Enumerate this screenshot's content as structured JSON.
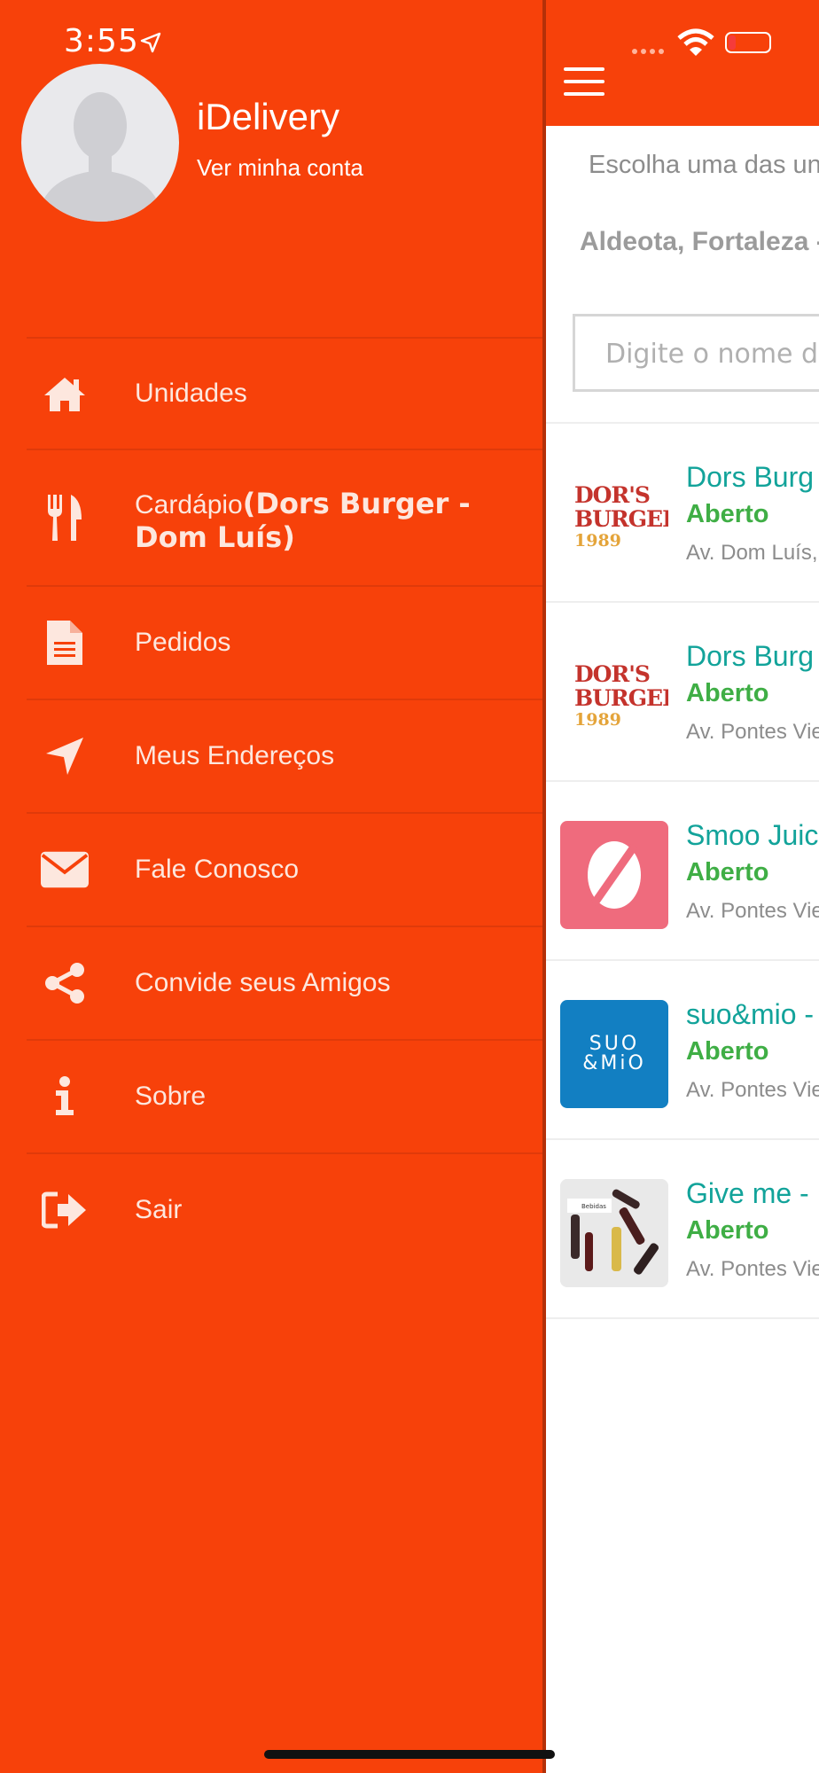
{
  "status_bar": {
    "time": "3:55"
  },
  "drawer": {
    "profile": {
      "name": "iDelivery",
      "link": "Ver minha conta"
    },
    "menu": [
      {
        "label": "Unidades",
        "icon": "home-icon"
      },
      {
        "label": "Cardápio",
        "label_bold": "(Dors Burger - Dom Luís)",
        "icon": "utensils-icon"
      },
      {
        "label": "Pedidos",
        "icon": "document-icon"
      },
      {
        "label": "Meus Endereços",
        "icon": "location-arrow-icon"
      },
      {
        "label": "Fale Conosco",
        "icon": "envelope-icon"
      },
      {
        "label": "Convide seus Amigos",
        "icon": "share-icon"
      },
      {
        "label": "Sobre",
        "icon": "info-icon"
      },
      {
        "label": "Sair",
        "icon": "sign-out-icon"
      }
    ]
  },
  "main": {
    "choose_text": "Escolha uma das unida",
    "location": "Aldeota, Fortaleza -",
    "search": {
      "placeholder": "Digite o nome do"
    },
    "units": [
      {
        "name": "Dors Burg",
        "status": "Aberto",
        "address": "Av. Dom Luís, n",
        "logo": {
          "line1": "DOR'S",
          "line2": "BURGER",
          "line3": "1989"
        }
      },
      {
        "name": "Dors Burg",
        "status": "Aberto",
        "address": "Av. Pontes Viei",
        "logo": {
          "line1": "DOR'S",
          "line2": "BURGER",
          "line3": "1989"
        }
      },
      {
        "name": "Smoo Juic",
        "status": "Aberto",
        "address": "Av. Pontes Viei"
      },
      {
        "name": "suo&mio -",
        "status": "Aberto",
        "address": "Av. Pontes Viei",
        "logo": {
          "line1": "SUO",
          "line2": "&MiO"
        }
      },
      {
        "name": "Give me -",
        "status": "Aberto",
        "address": "Av. Pontes Viei",
        "logo": {
          "caption": "Bebidas"
        }
      }
    ]
  },
  "colors": {
    "brand": "#f7410a",
    "unit_name": "#12a39a",
    "status_open": "#3fae45"
  }
}
